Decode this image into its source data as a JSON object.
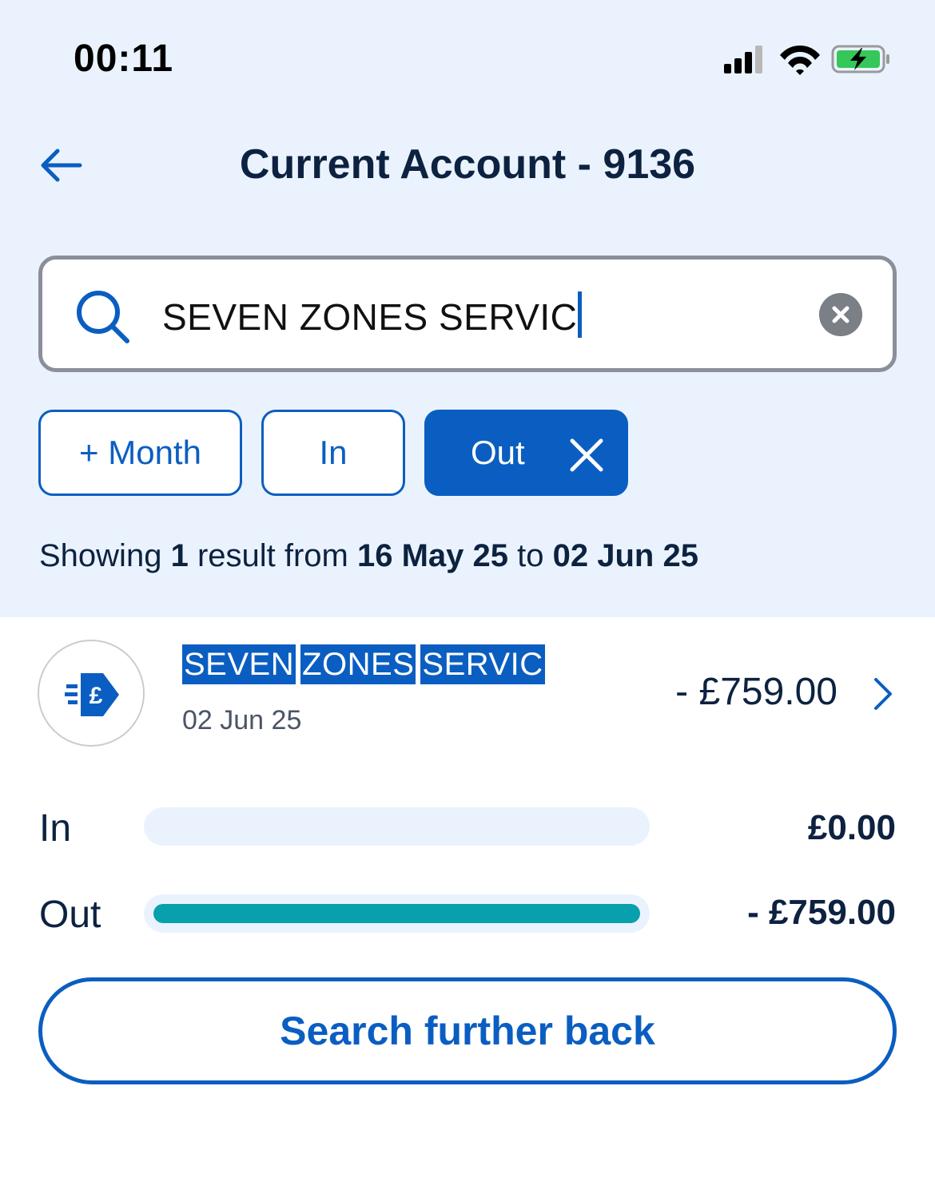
{
  "status_bar": {
    "time": "00:11"
  },
  "header": {
    "title": "Current Account - 9136"
  },
  "search": {
    "value": "SEVEN ZONES SERVIC"
  },
  "filters": {
    "month_label": "+ Month",
    "in_label": "In",
    "out_label": "Out",
    "active": "Out"
  },
  "summary": {
    "prefix": "Showing",
    "count": "1",
    "middle": "result from",
    "from_date": "16 May 25",
    "to_word": "to",
    "to_date": "02 Jun 25"
  },
  "transactions": [
    {
      "name_words": [
        "SEVEN",
        "ZONES",
        "SERVIC"
      ],
      "date": "02 Jun 25",
      "amount": "- £759.00",
      "icon": "pound-transfer-icon"
    }
  ],
  "totals": {
    "in_label": "In",
    "in_value": "£0.00",
    "in_fraction": 0,
    "out_label": "Out",
    "out_value": "- £759.00",
    "out_fraction": 1
  },
  "actions": {
    "search_further_back": "Search further back"
  },
  "colors": {
    "brand": "#0b5ec1",
    "navy": "#0d2240",
    "header_bg": "#eaf3fd",
    "out_bar": "#08a0ad"
  }
}
